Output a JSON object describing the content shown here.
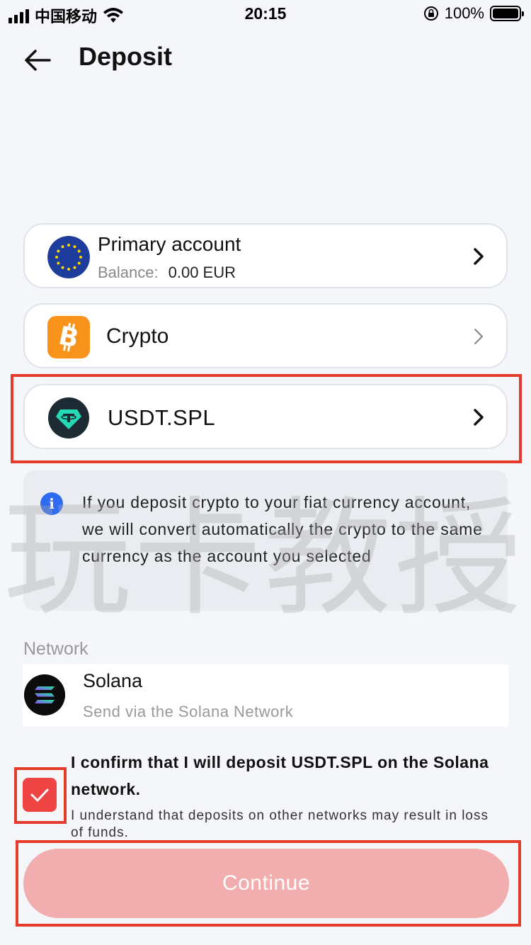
{
  "status_bar": {
    "carrier": "中国移动",
    "time": "20:15",
    "battery": "100%"
  },
  "header": {
    "title": "Deposit"
  },
  "account_card": {
    "title": "Primary account",
    "balance_label": "Balance:",
    "balance_value": "0.00 EUR",
    "icon": "eu-flag-icon"
  },
  "crypto_card": {
    "label": "Crypto",
    "icon": "bitcoin-icon"
  },
  "currency_card": {
    "label": "USDT.SPL",
    "icon": "tether-icon"
  },
  "info": {
    "text": "If you deposit crypto to your fiat currency account, we will convert automatically the crypto to the same currency as the account you selected"
  },
  "network": {
    "section_label": "Network",
    "name": "Solana",
    "subtitle": "Send via the Solana Network",
    "icon": "solana-icon"
  },
  "confirm": {
    "title": "I confirm that I will deposit USDT.SPL on the Solana network.",
    "subtitle": "I understand that deposits on other networks may result in loss of funds.",
    "checked": true
  },
  "continue_button": {
    "label": "Continue"
  },
  "watermark": "玩卡教授",
  "colors": {
    "accent": "#ef4444",
    "highlight": "#e53b2b",
    "button_disabled": "#f2aeae",
    "info": "#2f6bf0"
  }
}
